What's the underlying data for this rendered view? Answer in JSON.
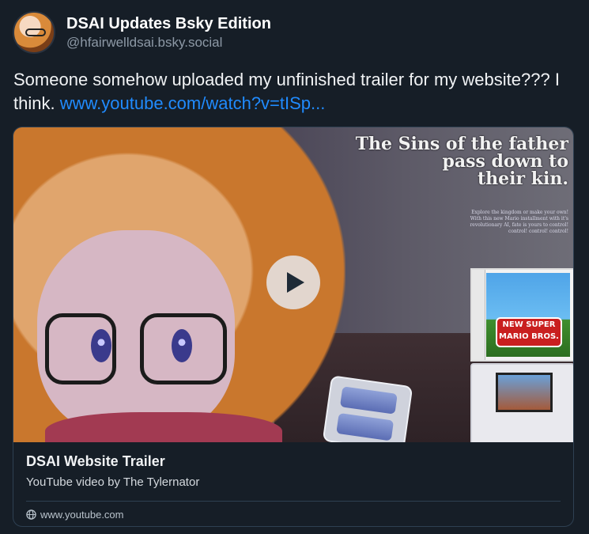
{
  "author": {
    "display_name": "DSAI Updates Bsky Edition",
    "handle": "@hfairwelldsai.bsky.social"
  },
  "post": {
    "text": "Someone somehow uploaded my unfinished trailer for my website??? I think.",
    "link_text": "www.youtube.com/watch?v=tISp..."
  },
  "embed": {
    "thumbnail_tagline_1": "The Sins of the father",
    "thumbnail_tagline_2": "pass down to",
    "thumbnail_tagline_3": "their kin.",
    "thumbnail_fineprint": "Explore the kingdom or make your own! With this new Mario installment with it's revolutionary AI, fate is yours to control! control! control! control!",
    "box_logo": "NEW SUPER MARIO BROS.",
    "play_icon": "play-icon",
    "title": "DSAI Website Trailer",
    "description": "YouTube video by The Tylernator",
    "domain": "www.youtube.com",
    "globe_icon": "globe-icon"
  },
  "colors": {
    "background": "#161e27",
    "link": "#208bfe",
    "border": "#2e4052",
    "muted": "#8d99a6"
  }
}
